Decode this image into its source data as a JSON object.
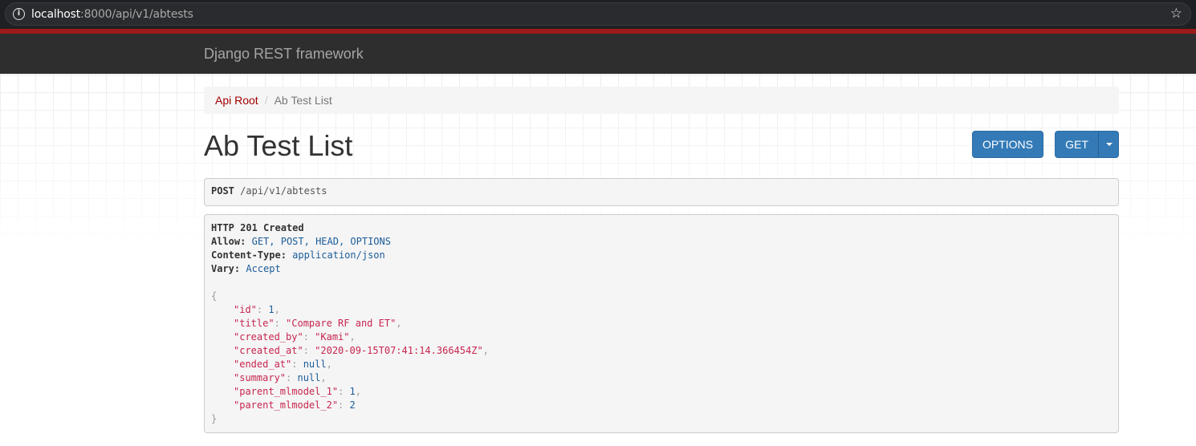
{
  "browser": {
    "url_host": "localhost",
    "url_rest": ":8000/api/v1/abtests"
  },
  "navbar": {
    "brand": "Django REST framework"
  },
  "breadcrumb": {
    "root_label": "Api Root",
    "separator": "/",
    "current_label": "Ab Test List"
  },
  "page": {
    "title": "Ab Test List"
  },
  "buttons": {
    "options_label": "OPTIONS",
    "get_label": "GET"
  },
  "request": {
    "method": "POST",
    "path": "/api/v1/abtests"
  },
  "response": {
    "status": "HTTP 201 Created",
    "headers": [
      {
        "name": "Allow:",
        "value": "GET, POST, HEAD, OPTIONS"
      },
      {
        "name": "Content-Type:",
        "value": "application/json"
      },
      {
        "name": "Vary:",
        "value": "Accept"
      }
    ],
    "open_brace": "{",
    "close_brace": "}",
    "body": [
      {
        "key": "\"id\"",
        "value": "1",
        "kind": "num",
        "comma": ","
      },
      {
        "key": "\"title\"",
        "value": "\"Compare RF and ET\"",
        "kind": "str",
        "comma": ","
      },
      {
        "key": "\"created_by\"",
        "value": "\"Kami\"",
        "kind": "str",
        "comma": ","
      },
      {
        "key": "\"created_at\"",
        "value": "\"2020-09-15T07:41:14.366454Z\"",
        "kind": "str",
        "comma": ","
      },
      {
        "key": "\"ended_at\"",
        "value": "null",
        "kind": "lit",
        "comma": ","
      },
      {
        "key": "\"summary\"",
        "value": "null",
        "kind": "lit",
        "comma": ","
      },
      {
        "key": "\"parent_mlmodel_1\"",
        "value": "1",
        "kind": "num",
        "comma": ","
      },
      {
        "key": "\"parent_mlmodel_2\"",
        "value": "2",
        "kind": "num",
        "comma": ""
      }
    ]
  },
  "colors": {
    "accent_red": "#a30000",
    "button_blue": "#337ab7",
    "navbar_bg": "#2e2e2e"
  }
}
